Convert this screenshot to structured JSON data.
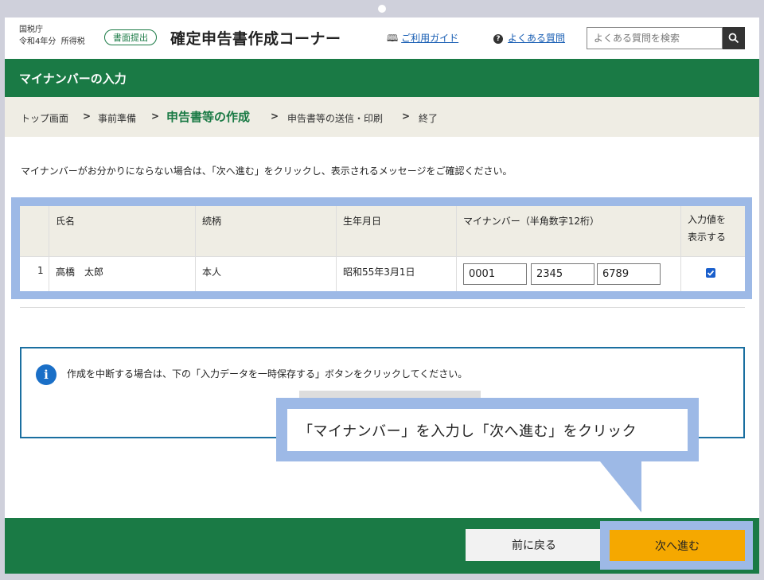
{
  "header": {
    "agency": "国税庁",
    "year_label": "令和4年分",
    "tax_type": "所得税",
    "badge": "書面提出",
    "title": "確定申告書作成コーナー",
    "guide_link": "ご利用ガイド",
    "faq_link": "よくある質問",
    "search_placeholder": "よくある質問を検索"
  },
  "page": {
    "title": "マイナンバーの入力"
  },
  "breadcrumb": {
    "items": [
      "トップ画面",
      "事前準備",
      "申告書等の作成",
      "申告書等の送信・印刷",
      "終了"
    ],
    "current_index": 2
  },
  "instruction": "マイナンバーがお分かりにならない場合は、「次へ進む」をクリックし、表示されるメッセージをご確認ください。",
  "table": {
    "columns": [
      "",
      "氏名",
      "続柄",
      "生年月日",
      "マイナンバー（半角数字12桁）",
      "入力値を\n表示する"
    ],
    "rows": [
      {
        "no": "1",
        "name": "高橋　太郎",
        "relation": "本人",
        "birthdate": "昭和55年3月1日",
        "mynumber": [
          "0001",
          "2345",
          "6789"
        ],
        "show_value": true
      }
    ]
  },
  "notice": {
    "text": "作成を中断する場合は、下の「入力データを一時保存する」ボタンをクリックしてください。"
  },
  "callout": {
    "text": "「マイナンバー」を入力し「次へ進む」をクリック"
  },
  "footer": {
    "back_label": "前に戻る",
    "next_label": "次へ進む"
  },
  "colors": {
    "brand_green": "#1a7a45",
    "next_button": "#f5a800",
    "highlight": "#9db9e6",
    "link": "#1a5fb4"
  },
  "icons": [
    "book-icon",
    "question-icon",
    "search-icon",
    "info-icon",
    "chevron-right-icon",
    "checkbox-checked-icon"
  ]
}
